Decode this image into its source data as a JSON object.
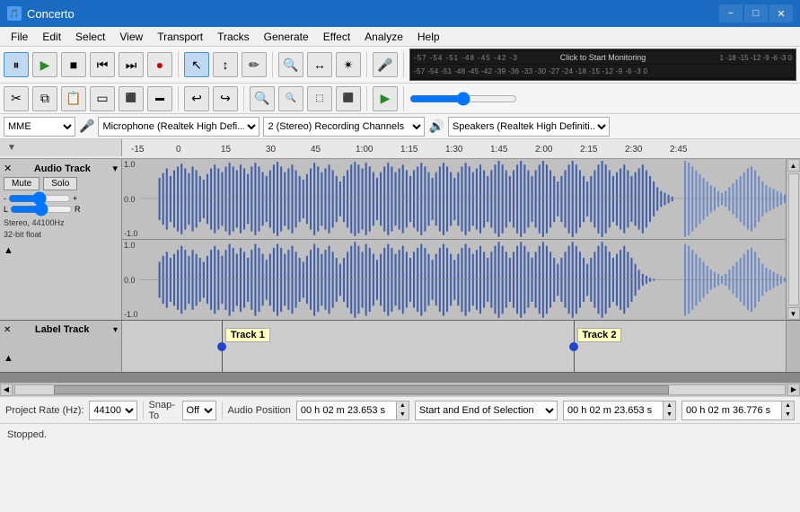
{
  "app": {
    "title": "Concerto",
    "icon": "🎵"
  },
  "titlebar": {
    "minimize_label": "−",
    "maximize_label": "□",
    "close_label": "✕"
  },
  "menu": {
    "items": [
      "File",
      "Edit",
      "Select",
      "View",
      "Transport",
      "Tracks",
      "Generate",
      "Effect",
      "Analyze",
      "Help"
    ]
  },
  "toolbar": {
    "play_pause": "⏸",
    "play": "▶",
    "stop": "■",
    "skip_back": "⏮",
    "skip_forward": "⏭",
    "record": "●",
    "vu_text": "Click to Start Monitoring",
    "vu_scale": "-57 -54 -51 -48 -45 -42 -3",
    "vu_scale2": "-57 -54 -51 -48 -45 -42 -39 -36 -33 -30 -27 -24 -18 -15 -12 -9 -6 -3 0",
    "right_scale": "1 -18 -15 -12 -9 -6 -3 0"
  },
  "tools": {
    "select": "↖",
    "envelope": "↕",
    "draw": "✏",
    "zoom": "🔍",
    "timeshift": "↔",
    "multi": "✴",
    "mic": "🎤",
    "cut": "✂",
    "copy": "⧉",
    "paste": "📋",
    "silence": "▭",
    "undo": "↩",
    "redo": "↪",
    "zoom_in": "🔍+",
    "zoom_out": "🔍-"
  },
  "device_row": {
    "mme": "MME",
    "mic_label": "🎤",
    "mic_device": "Microphone (Realtek High Defi...",
    "channels": "2 (Stereo) Recording Channels",
    "speaker_label": "🔊",
    "speaker_device": "Speakers (Realtek High Definiti..."
  },
  "ruler": {
    "labels": [
      "-15",
      "0",
      "15",
      "30",
      "45",
      "1:00",
      "1:15",
      "1:30",
      "1:45",
      "2:00",
      "2:15",
      "2:30",
      "2:45"
    ]
  },
  "audio_track": {
    "name": "Audio Track",
    "close": "✕",
    "dropdown": "▾",
    "mute": "Mute",
    "solo": "Solo",
    "gain_left": "-",
    "gain_right": "+",
    "pan_left": "L",
    "pan_right": "R",
    "info": "Stereo, 44100Hz\n32-bit float",
    "expand": "▲",
    "y_top_1": "1.0",
    "y_zero_1": "0.0",
    "y_bot_1": "-1.0",
    "y_top_2": "1.0",
    "y_zero_2": "0.0",
    "y_bot_2": "-1.0"
  },
  "label_track": {
    "name": "Label Track",
    "close": "✕",
    "dropdown": "▾",
    "expand": "▲",
    "marker1": {
      "text": "Track 1",
      "position_percent": 15
    },
    "marker2": {
      "text": "Track 2",
      "position_percent": 68
    }
  },
  "status": {
    "text": "Stopped."
  },
  "bottom_toolbar": {
    "project_rate_label": "Project Rate (Hz):",
    "project_rate": "44100",
    "snap_to_label": "Snap-To",
    "snap_to": "Off",
    "audio_position_label": "Audio Position",
    "selection_label": "Start and End of Selection",
    "time1": "00 h 02 m 23.653 s",
    "time2": "00 h 02 m 23.653 s",
    "time3": "00 h 02 m 36.776 s"
  }
}
